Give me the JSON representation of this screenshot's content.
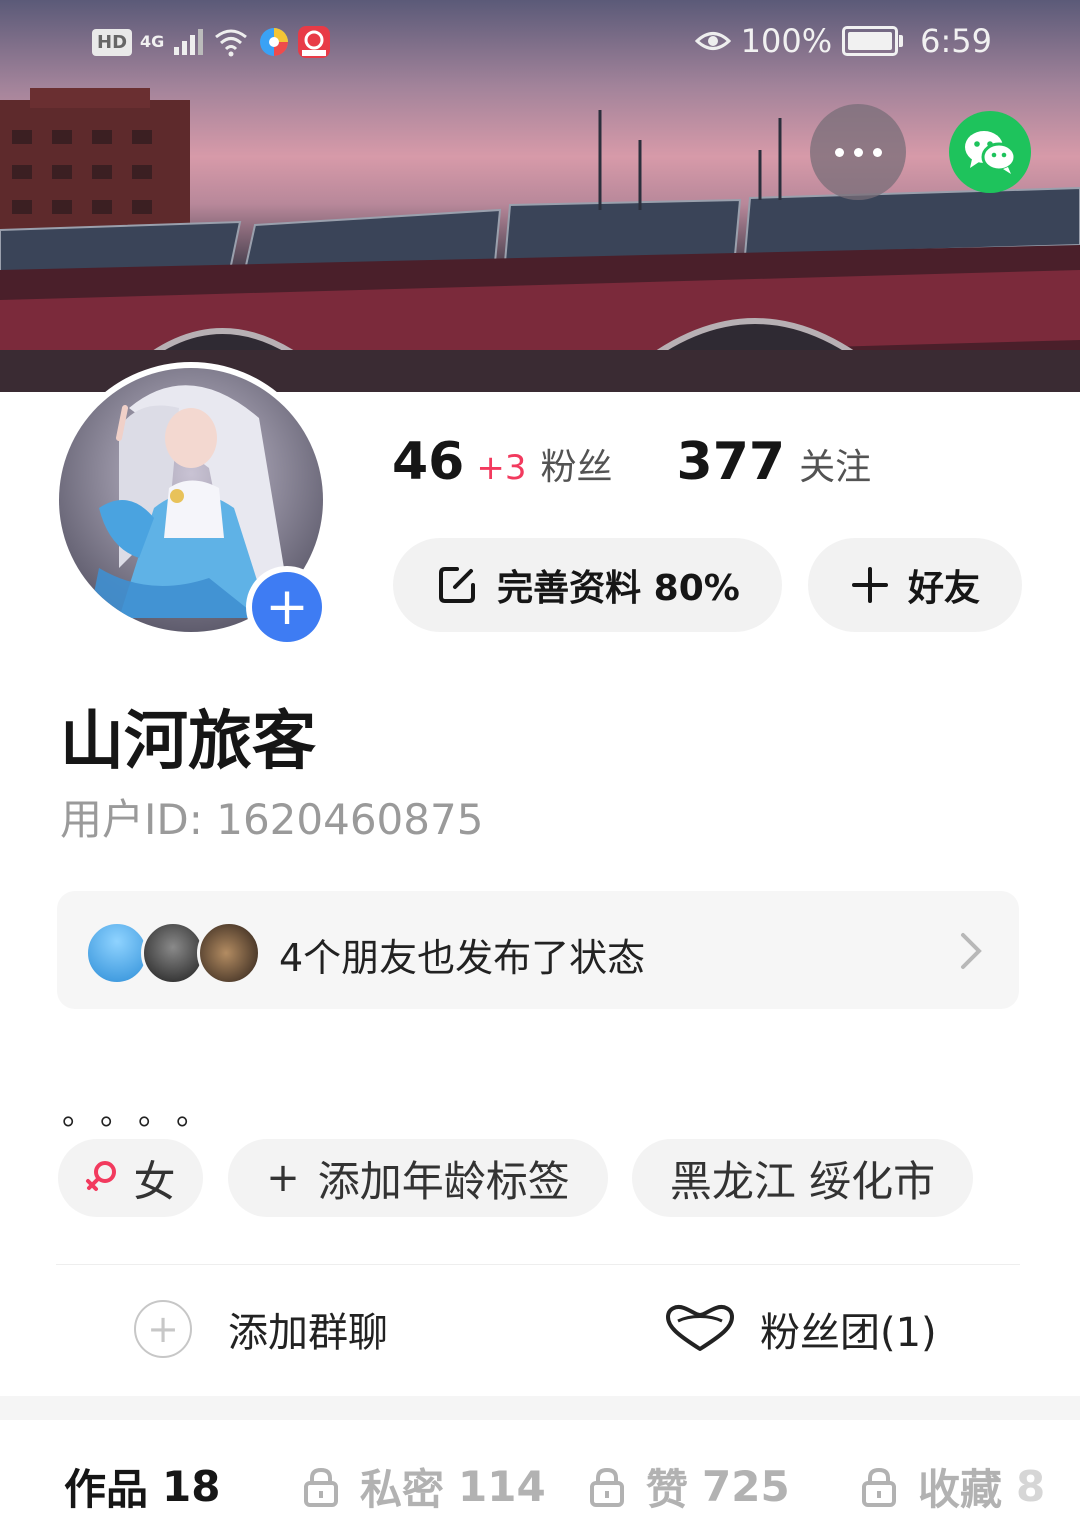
{
  "status_bar": {
    "hd": "HD",
    "network": "4G",
    "battery_percent": "100%",
    "time": "6:59"
  },
  "header": {
    "more_icon": "ellipsis-icon",
    "share_icon": "wechat-icon"
  },
  "stats": {
    "fans_count": "46",
    "fans_delta": "+3",
    "fans_label": "粉丝",
    "following_count": "377",
    "following_label": "关注"
  },
  "actions": {
    "complete_profile": "完善资料 80%",
    "add_friend": "好友"
  },
  "profile": {
    "name": "山河旅客",
    "user_id": "用户ID: 1620460875"
  },
  "friends_strip": {
    "text": "4个朋友也发布了状态"
  },
  "bio": "。。。。",
  "tags": {
    "gender": "女",
    "age": "添加年龄标签",
    "location": "黑龙江 绥化市"
  },
  "groups": {
    "add_group": "添加群聊",
    "fan_club": "粉丝团(1)"
  },
  "tabs": [
    {
      "label": "作品",
      "count": "18"
    },
    {
      "label": "私密",
      "count": "114"
    },
    {
      "label": "赞",
      "count": "725"
    },
    {
      "label": "收藏",
      "count": "8"
    }
  ],
  "colors": {
    "accent_pink": "#f23a5e",
    "wechat_green": "#1ec35c",
    "avatar_add_blue": "#3e7cf3"
  }
}
